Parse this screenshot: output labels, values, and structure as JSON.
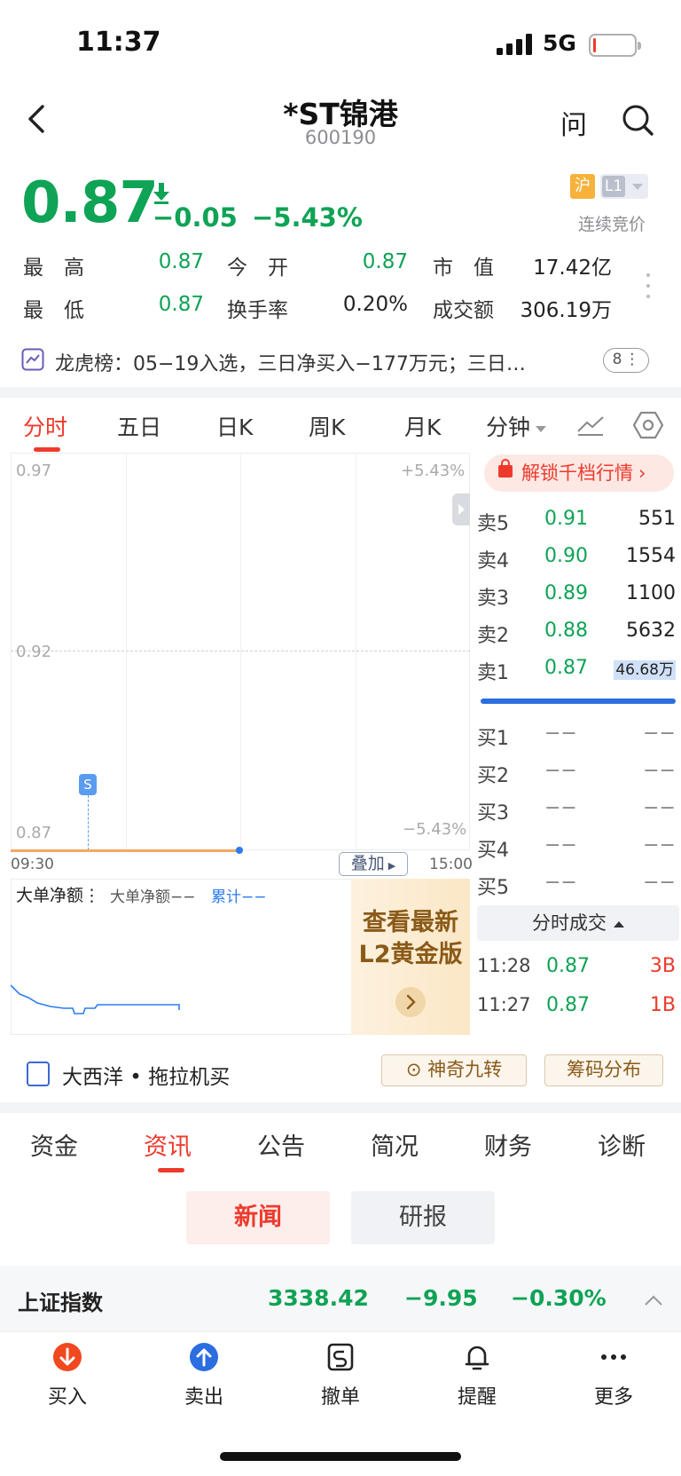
{
  "status": {
    "time": "11:37",
    "network": "5G"
  },
  "header": {
    "title": "*ST锦港",
    "code": "600190",
    "ask": "问"
  },
  "quote": {
    "price": "0.87",
    "change": "−0.05",
    "change_pct": "−5.43%",
    "exchange_badge": "沪",
    "level_badge": "L1",
    "trade_status": "连续竞价",
    "stats": [
      {
        "label": "最　高",
        "value": "0.87",
        "color": "#0fa355"
      },
      {
        "label": "今　开",
        "value": "0.87",
        "color": "#0fa355"
      },
      {
        "label": "市　值",
        "value": "17.42亿",
        "color": "#222222"
      },
      {
        "label": "最　低",
        "value": "0.87",
        "color": "#0fa355"
      },
      {
        "label": "换手率",
        "value": "0.20%",
        "color": "#222222"
      },
      {
        "label": "成交额",
        "value": "306.19万",
        "color": "#222222"
      }
    ]
  },
  "dragon_tiger": {
    "text": "龙虎榜：05−19入选，三日净买入−177万元；三日…",
    "count": "8"
  },
  "chart_tabs": [
    "分时",
    "五日",
    "日K",
    "周K",
    "月K",
    "分钟"
  ],
  "chart": {
    "y_top": "0.97",
    "y_top_pct": "+5.43%",
    "y_mid": "0.92",
    "y_bottom": "0.87",
    "y_bottom_pct": "−5.43%",
    "x_start": "09:30",
    "x_end": "15:00",
    "s_marker": "S",
    "overlay": "叠加"
  },
  "big_order": {
    "title": "大单净额",
    "sub": "大单净额−−",
    "cumulative": "累计−−"
  },
  "l2_ad": {
    "line1": "查看最新",
    "line2": "L2黄金版"
  },
  "order_book": {
    "unlock": "解锁千档行情",
    "asks": [
      {
        "label": "卖5",
        "price": "0.91",
        "vol": "551"
      },
      {
        "label": "卖4",
        "price": "0.90",
        "vol": "1554"
      },
      {
        "label": "卖3",
        "price": "0.89",
        "vol": "1100"
      },
      {
        "label": "卖2",
        "price": "0.88",
        "vol": "5632"
      },
      {
        "label": "卖1",
        "price": "0.87",
        "vol": "46.68万"
      }
    ],
    "bids": [
      {
        "label": "买1",
        "price": "−−",
        "vol": "−−"
      },
      {
        "label": "买2",
        "price": "−−",
        "vol": "−−"
      },
      {
        "label": "买3",
        "price": "−−",
        "vol": "−−"
      },
      {
        "label": "买4",
        "price": "−−",
        "vol": "−−"
      },
      {
        "label": "买5",
        "price": "−−",
        "vol": "−−"
      }
    ]
  },
  "ticks": {
    "header": "分时成交",
    "rows": [
      {
        "time": "11:28",
        "price": "0.87",
        "vol": "3B"
      },
      {
        "time": "11:27",
        "price": "0.87",
        "vol": "1B"
      }
    ]
  },
  "strategy": {
    "text": "大西洋 • 拖拉机买",
    "chip1": "神奇九转",
    "chip2": "筹码分布"
  },
  "info_tabs": [
    "资金",
    "资讯",
    "公告",
    "简况",
    "财务",
    "诊断"
  ],
  "news_pills": [
    "新闻",
    "研报"
  ],
  "index": {
    "name": "上证指数",
    "value": "3338.42",
    "change": "−9.95",
    "change_pct": "−0.30%"
  },
  "bottom_bar": [
    "买入",
    "卖出",
    "撤单",
    "提醒",
    "更多"
  ],
  "colors": {
    "down": "#0fa355",
    "up": "#ee3a2c",
    "accent_blue": "#2c7bf0"
  }
}
